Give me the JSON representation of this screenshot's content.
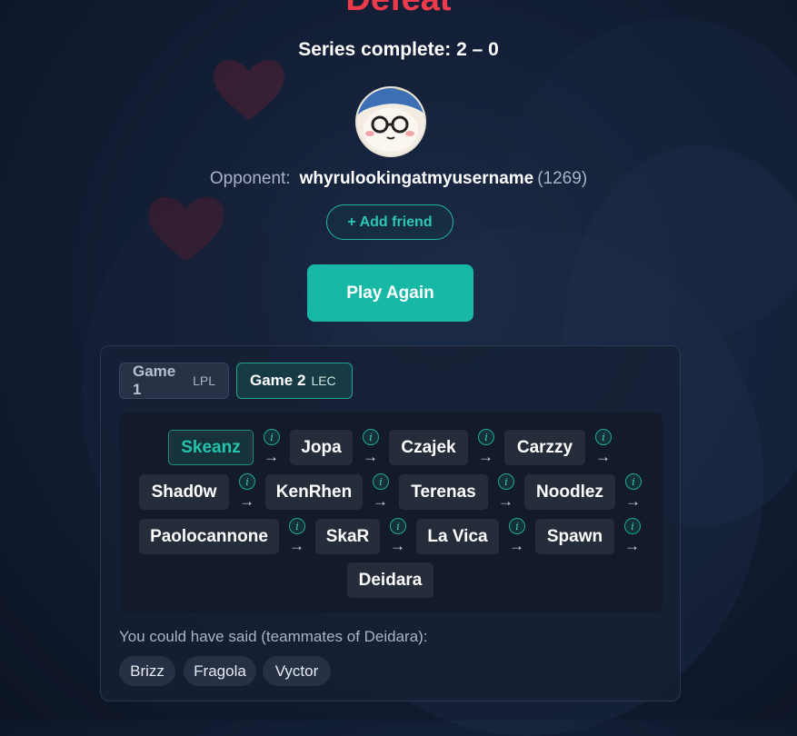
{
  "result_title": "Defeat",
  "series_text": "Series complete: 2 – 0",
  "opponent": {
    "label": "Opponent:",
    "username": "whyrulookingatmyusername",
    "rating": "(1269)"
  },
  "add_friend_label": "+ Add friend",
  "play_again_label": "Play Again",
  "tabs": [
    {
      "label": "Game 1",
      "league": "LPL",
      "selected": false
    },
    {
      "label": "Game 2",
      "league": "LEC",
      "selected": true
    }
  ],
  "chain": [
    {
      "name": "Skeanz"
    },
    {
      "name": "Jopa"
    },
    {
      "name": "Czajek"
    },
    {
      "name": "Carzzy"
    },
    {
      "name": "Shad0w"
    },
    {
      "name": "KenRhen"
    },
    {
      "name": "Terenas"
    },
    {
      "name": "Noodlez"
    },
    {
      "name": "Paolocannone"
    },
    {
      "name": "SkaR"
    },
    {
      "name": "La Vica"
    },
    {
      "name": "Spawn"
    },
    {
      "name": "Deidara"
    }
  ],
  "info_glyph": "i",
  "arrow_glyph": "→",
  "could_have_said": "You could have said (teammates of Deidara):",
  "suggestions": [
    "Brizz",
    "Fragola",
    "Vyctor"
  ],
  "colors": {
    "defeat": "#ee3b4b",
    "accent": "#17b8a6",
    "background": "#131f36"
  }
}
